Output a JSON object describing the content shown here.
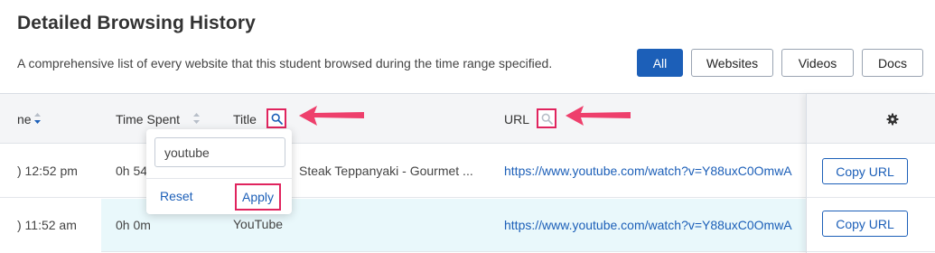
{
  "header": {
    "title": "Detailed Browsing History",
    "description": "A comprehensive list of every website that this student browsed during the time range specified."
  },
  "filters": [
    {
      "label": "All",
      "active": true
    },
    {
      "label": "Websites",
      "active": false
    },
    {
      "label": "Videos",
      "active": false
    },
    {
      "label": "Docs",
      "active": false
    }
  ],
  "table": {
    "columns": {
      "time_partial": "ne",
      "time_spent": "Time Spent",
      "title": "Title",
      "url": "URL"
    },
    "rows": [
      {
        "time": ") 12:52 pm",
        "spent": "0h 54",
        "title": "Steak Teppanyaki - Gourmet ...",
        "url": "https://www.youtube.com/watch?v=Y88uxC0OmwA",
        "action": "Copy URL"
      },
      {
        "time": ") 11:52 am",
        "spent": "0h 0m",
        "title": "YouTube",
        "url": "https://www.youtube.com/watch?v=Y88uxC0OmwA",
        "action": "Copy URL"
      }
    ]
  },
  "title_filter_popup": {
    "value": "youtube",
    "reset_label": "Reset",
    "apply_label": "Apply"
  },
  "colors": {
    "accent": "#1c5fb8",
    "highlight": "#e0245e",
    "row_highlight": "#e9f8fb"
  },
  "icons": [
    "sort-icon",
    "search-icon",
    "gear-icon",
    "arrow-annotation"
  ]
}
